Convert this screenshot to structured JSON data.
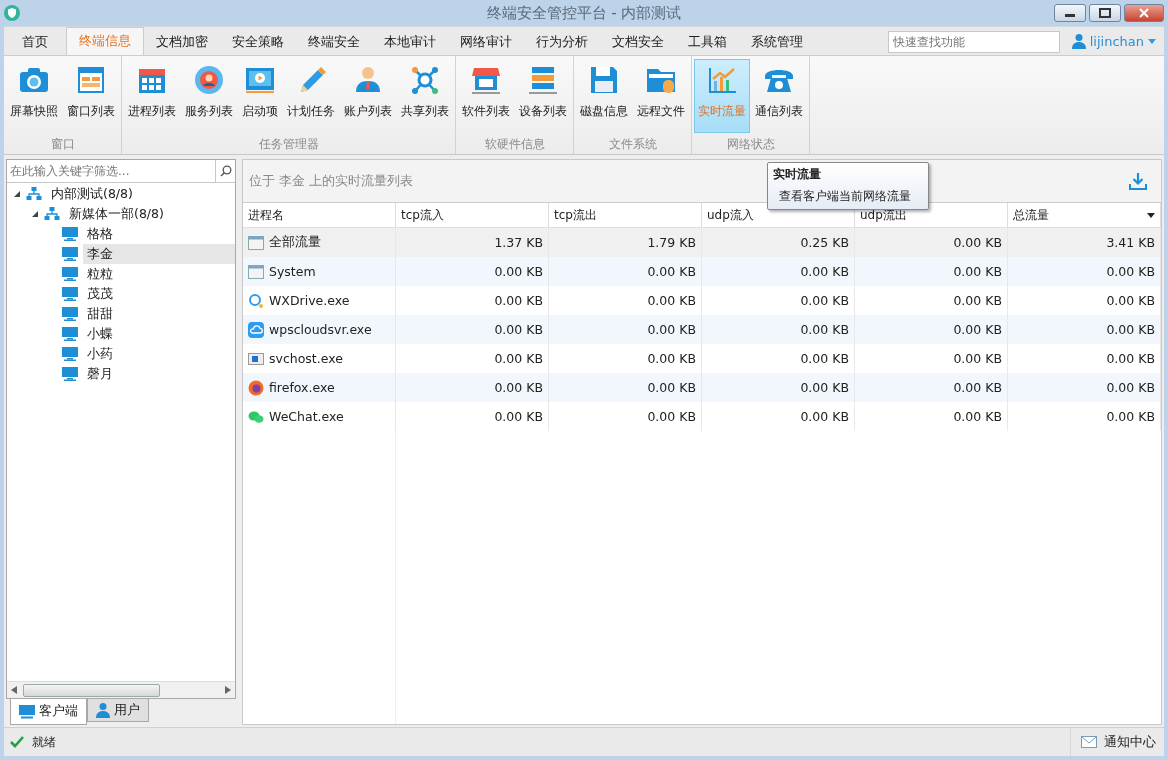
{
  "window": {
    "title": "终端安全管控平台 - 内部测试"
  },
  "tabs": [
    {
      "label": "首页",
      "selected": false
    },
    {
      "label": "终端信息",
      "selected": true
    },
    {
      "label": "文档加密",
      "selected": false
    },
    {
      "label": "安全策略",
      "selected": false
    },
    {
      "label": "终端安全",
      "selected": false
    },
    {
      "label": "本地审计",
      "selected": false
    },
    {
      "label": "网络审计",
      "selected": false
    },
    {
      "label": "行为分析",
      "selected": false
    },
    {
      "label": "文档安全",
      "selected": false
    },
    {
      "label": "工具箱",
      "selected": false
    },
    {
      "label": "系统管理",
      "selected": false
    }
  ],
  "quick_search": {
    "placeholder": "快速查找功能"
  },
  "user": {
    "name": "lijinchan"
  },
  "ribbon_groups": [
    {
      "label": "窗口",
      "buttons": [
        {
          "label": "屏幕快照",
          "selected": false
        },
        {
          "label": "窗口列表",
          "selected": false
        }
      ]
    },
    {
      "label": "任务管理器",
      "buttons": [
        {
          "label": "进程列表",
          "selected": false
        },
        {
          "label": "服务列表",
          "selected": false
        },
        {
          "label": "启动项",
          "selected": false
        },
        {
          "label": "计划任务",
          "selected": false
        },
        {
          "label": "账户列表",
          "selected": false
        },
        {
          "label": "共享列表",
          "selected": false
        }
      ]
    },
    {
      "label": "软硬件信息",
      "buttons": [
        {
          "label": "软件列表",
          "selected": false
        },
        {
          "label": "设备列表",
          "selected": false
        }
      ]
    },
    {
      "label": "文件系统",
      "buttons": [
        {
          "label": "磁盘信息",
          "selected": false
        },
        {
          "label": "远程文件",
          "selected": false
        }
      ]
    },
    {
      "label": "网络状态",
      "buttons": [
        {
          "label": "实时流量",
          "selected": true
        },
        {
          "label": "通信列表",
          "selected": false
        }
      ]
    }
  ],
  "tooltip": {
    "title": "实时流量",
    "text": "查看客户端当前网络流量"
  },
  "sidebar": {
    "filter": {
      "placeholder": "在此输入关键字筛选..."
    },
    "tree": [
      {
        "label": "内部测试(8/8)",
        "expanded": true,
        "selected": false,
        "children": [
          {
            "label": "新媒体一部(8/8)",
            "expanded": true,
            "selected": false,
            "children": [
              {
                "label": "格格",
                "selected": false
              },
              {
                "label": "李金",
                "selected": true
              },
              {
                "label": "粒粒",
                "selected": false
              },
              {
                "label": "茂茂",
                "selected": false
              },
              {
                "label": "甜甜",
                "selected": false
              },
              {
                "label": "小蝶",
                "selected": false
              },
              {
                "label": "小药",
                "selected": false
              },
              {
                "label": "磬月",
                "selected": false
              }
            ]
          }
        ]
      }
    ],
    "bottom_tabs": [
      {
        "label": "客户端",
        "selected": true
      },
      {
        "label": "用户",
        "selected": false
      }
    ]
  },
  "content": {
    "caption": "位于 李金 上的实时流量列表",
    "table": {
      "columns": [
        "进程名",
        "tcp流入",
        "tcp流出",
        "udp流入",
        "udp流出",
        "总流量"
      ],
      "rows": [
        [
          "全部流量",
          "1.37 KB",
          "1.79 KB",
          "0.25 KB",
          "0.00 KB",
          "3.41 KB"
        ],
        [
          "System",
          "0.00 KB",
          "0.00 KB",
          "0.00 KB",
          "0.00 KB",
          "0.00 KB"
        ],
        [
          "WXDrive.exe",
          "0.00 KB",
          "0.00 KB",
          "0.00 KB",
          "0.00 KB",
          "0.00 KB"
        ],
        [
          "wpscloudsvr.exe",
          "0.00 KB",
          "0.00 KB",
          "0.00 KB",
          "0.00 KB",
          "0.00 KB"
        ],
        [
          "svchost.exe",
          "0.00 KB",
          "0.00 KB",
          "0.00 KB",
          "0.00 KB",
          "0.00 KB"
        ],
        [
          "firefox.exe",
          "0.00 KB",
          "0.00 KB",
          "0.00 KB",
          "0.00 KB",
          "0.00 KB"
        ],
        [
          "WeChat.exe",
          "0.00 KB",
          "0.00 KB",
          "0.00 KB",
          "0.00 KB",
          "0.00 KB"
        ]
      ]
    }
  },
  "status_bar": {
    "status": "就绪",
    "notifications": "通知中心"
  }
}
